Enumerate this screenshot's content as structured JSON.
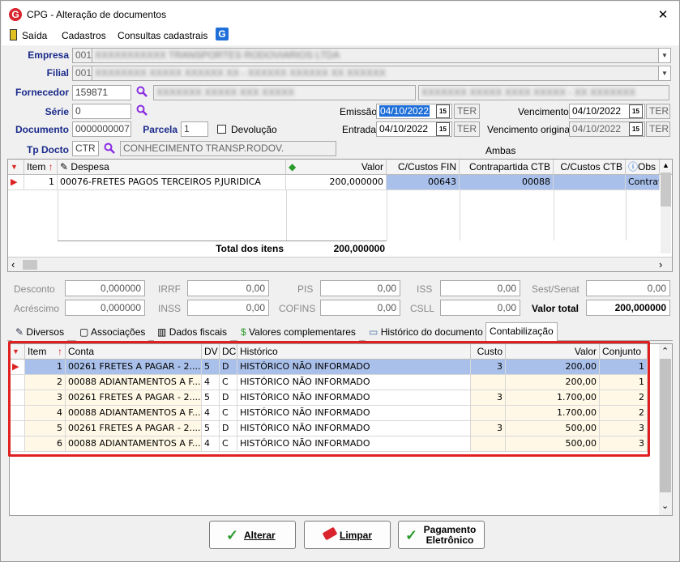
{
  "window": {
    "title": "CPG - Alteração de documentos",
    "close": "✕"
  },
  "menu": {
    "items": [
      "Saída",
      "Cadastros",
      "Consultas cadastrais"
    ]
  },
  "form": {
    "empresa_label": "Empresa",
    "empresa_code": "001",
    "empresa_name": "XXXXXXXXXXX TRANSPORTES RODOVIARIOS LTDA",
    "filial_label": "Filial",
    "filial_code": "001",
    "filial_name": "XXXXXXXX XXXXX XXXXXX XX - XXXXXX XXXXXX XX XXXXXX",
    "fornecedor_label": "Fornecedor",
    "fornecedor_code": "159871",
    "fornecedor_name": "XXXXXXX XXXXX XXX XXXXX",
    "fornecedor_doc": "XXXXXXX XXXXX XXXX XXXXX - XX XXXXXXX",
    "serie_label": "Série",
    "serie_value": "0",
    "documento_label": "Documento",
    "documento_value": "0000000007",
    "parcela_label": "Parcela",
    "parcela_value": "1",
    "devolucao_label": "Devolução",
    "emissao_label": "Emissão",
    "emissao_value": "04/10/2022",
    "emissao_day": "TER",
    "entrada_label": "Entrada",
    "entrada_value": "04/10/2022",
    "entrada_day": "TER",
    "vencimento_label": "Vencimento",
    "vencimento_value": "04/10/2022",
    "vencimento_day": "TER",
    "venc_original_label": "Vencimento original",
    "venc_original_value": "04/10/2022",
    "venc_original_day": "TER",
    "ambas": "Ambas",
    "tpdocto_label": "Tp Docto",
    "tpdocto_code": "CTR",
    "tpdocto_desc": "CONHECIMENTO TRANSP.RODOV."
  },
  "items_grid": {
    "headers": [
      "Item",
      "Despesa",
      "Valor",
      "C/Custos FIN",
      "Contrapartida CTB",
      "C/Custos CTB",
      "Obs"
    ],
    "rows": [
      {
        "item": "1",
        "despesa": "00076-FRETES PAGOS TERCEIROS P.JURIDICA",
        "valor": "200,000000",
        "ccfin": "00643",
        "contrapartida": "00088",
        "ccctb": "",
        "obs": "Contrato"
      }
    ],
    "total_label": "Total dos itens",
    "total_value": "200,000000"
  },
  "totals": {
    "desconto_label": "Desconto",
    "desconto": "0,000000",
    "acrescimo_label": "Acréscimo",
    "acrescimo": "0,000000",
    "irrf_label": "IRRF",
    "irrf": "0,00",
    "inss_label": "INSS",
    "inss": "0,00",
    "pis_label": "PIS",
    "pis": "0,00",
    "cofins_label": "COFINS",
    "cofins": "0,00",
    "iss_label": "ISS",
    "iss": "0,00",
    "csll_label": "CSLL",
    "csll": "0,00",
    "sest_label": "Sest/Senat",
    "sest": "0,00",
    "valor_total_label": "Valor total",
    "valor_total": "200,000000"
  },
  "tabs": [
    "Diversos",
    "Associações",
    "Dados fiscais",
    "Valores complementares",
    "Histórico do documento",
    "Contabilização"
  ],
  "accounting_grid": {
    "headers": [
      "Item",
      "Conta",
      "DV",
      "DC",
      "Histórico",
      "Custo",
      "Valor",
      "Conjunto"
    ],
    "rows": [
      {
        "item": "1",
        "conta": "00261 FRETES A PAGAR - 2....",
        "dv": "5",
        "dc": "D",
        "historico": "HISTÓRICO NÃO INFORMADO",
        "custo": "3",
        "valor": "200,00",
        "conjunto": "1"
      },
      {
        "item": "2",
        "conta": "00088 ADIANTAMENTOS A F...",
        "dv": "4",
        "dc": "C",
        "historico": "HISTÓRICO NÃO INFORMADO",
        "custo": "",
        "valor": "200,00",
        "conjunto": "1"
      },
      {
        "item": "3",
        "conta": "00261 FRETES A PAGAR - 2....",
        "dv": "5",
        "dc": "D",
        "historico": "HISTÓRICO NÃO INFORMADO",
        "custo": "3",
        "valor": "1.700,00",
        "conjunto": "2"
      },
      {
        "item": "4",
        "conta": "00088 ADIANTAMENTOS A F...",
        "dv": "4",
        "dc": "C",
        "historico": "HISTÓRICO NÃO INFORMADO",
        "custo": "",
        "valor": "1.700,00",
        "conjunto": "2"
      },
      {
        "item": "5",
        "conta": "00261 FRETES A PAGAR - 2....",
        "dv": "5",
        "dc": "D",
        "historico": "HISTÓRICO NÃO INFORMADO",
        "custo": "3",
        "valor": "500,00",
        "conjunto": "3"
      },
      {
        "item": "6",
        "conta": "00088 ADIANTAMENTOS A F...",
        "dv": "4",
        "dc": "C",
        "historico": "HISTÓRICO NÃO INFORMADO",
        "custo": "",
        "valor": "500,00",
        "conjunto": "3"
      }
    ]
  },
  "buttons": {
    "alterar": "Alterar",
    "limpar": "Limpar",
    "pagamento_1": "Pagamento",
    "pagamento_2": "Eletrônico"
  },
  "colors": {
    "label_blue": "#1a2a8a",
    "selected_row": "#a9c0ea",
    "highlight_red": "#e02020",
    "accent": "#1e6fd9"
  }
}
